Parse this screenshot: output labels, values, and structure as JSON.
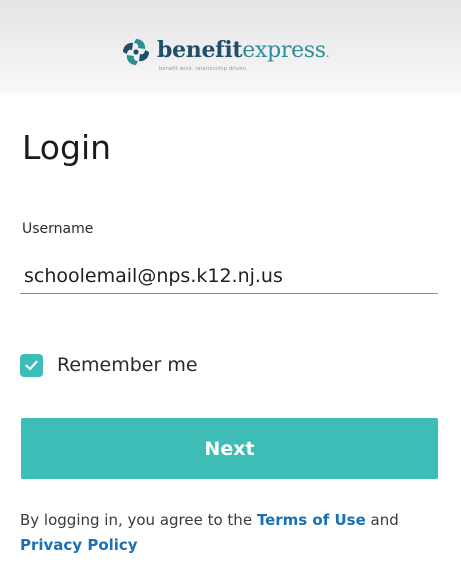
{
  "header": {
    "logo": {
      "brand_part1": "benefit",
      "brand_part2": "express",
      "brand_dot": ".",
      "tagline": "benefit wise. relationship driven."
    }
  },
  "login": {
    "title": "Login",
    "username_label": "Username",
    "username_value": "schoolemail@nps.k12.nj.us",
    "remember_label": "Remember me",
    "remember_checked": true,
    "next_label": "Next",
    "legal_prefix": "By logging in, you agree to the ",
    "terms_link": "Terms of Use",
    "legal_and": " and ",
    "privacy_link": "Privacy Policy"
  },
  "colors": {
    "accent": "#3ebcb6",
    "link": "#1a6fb5",
    "brand_dark": "#1f4e6b",
    "brand_teal": "#2f8d95"
  },
  "icons": {
    "logo": "benefitexpress-swirl-icon",
    "checkbox": "checkmark-icon"
  }
}
